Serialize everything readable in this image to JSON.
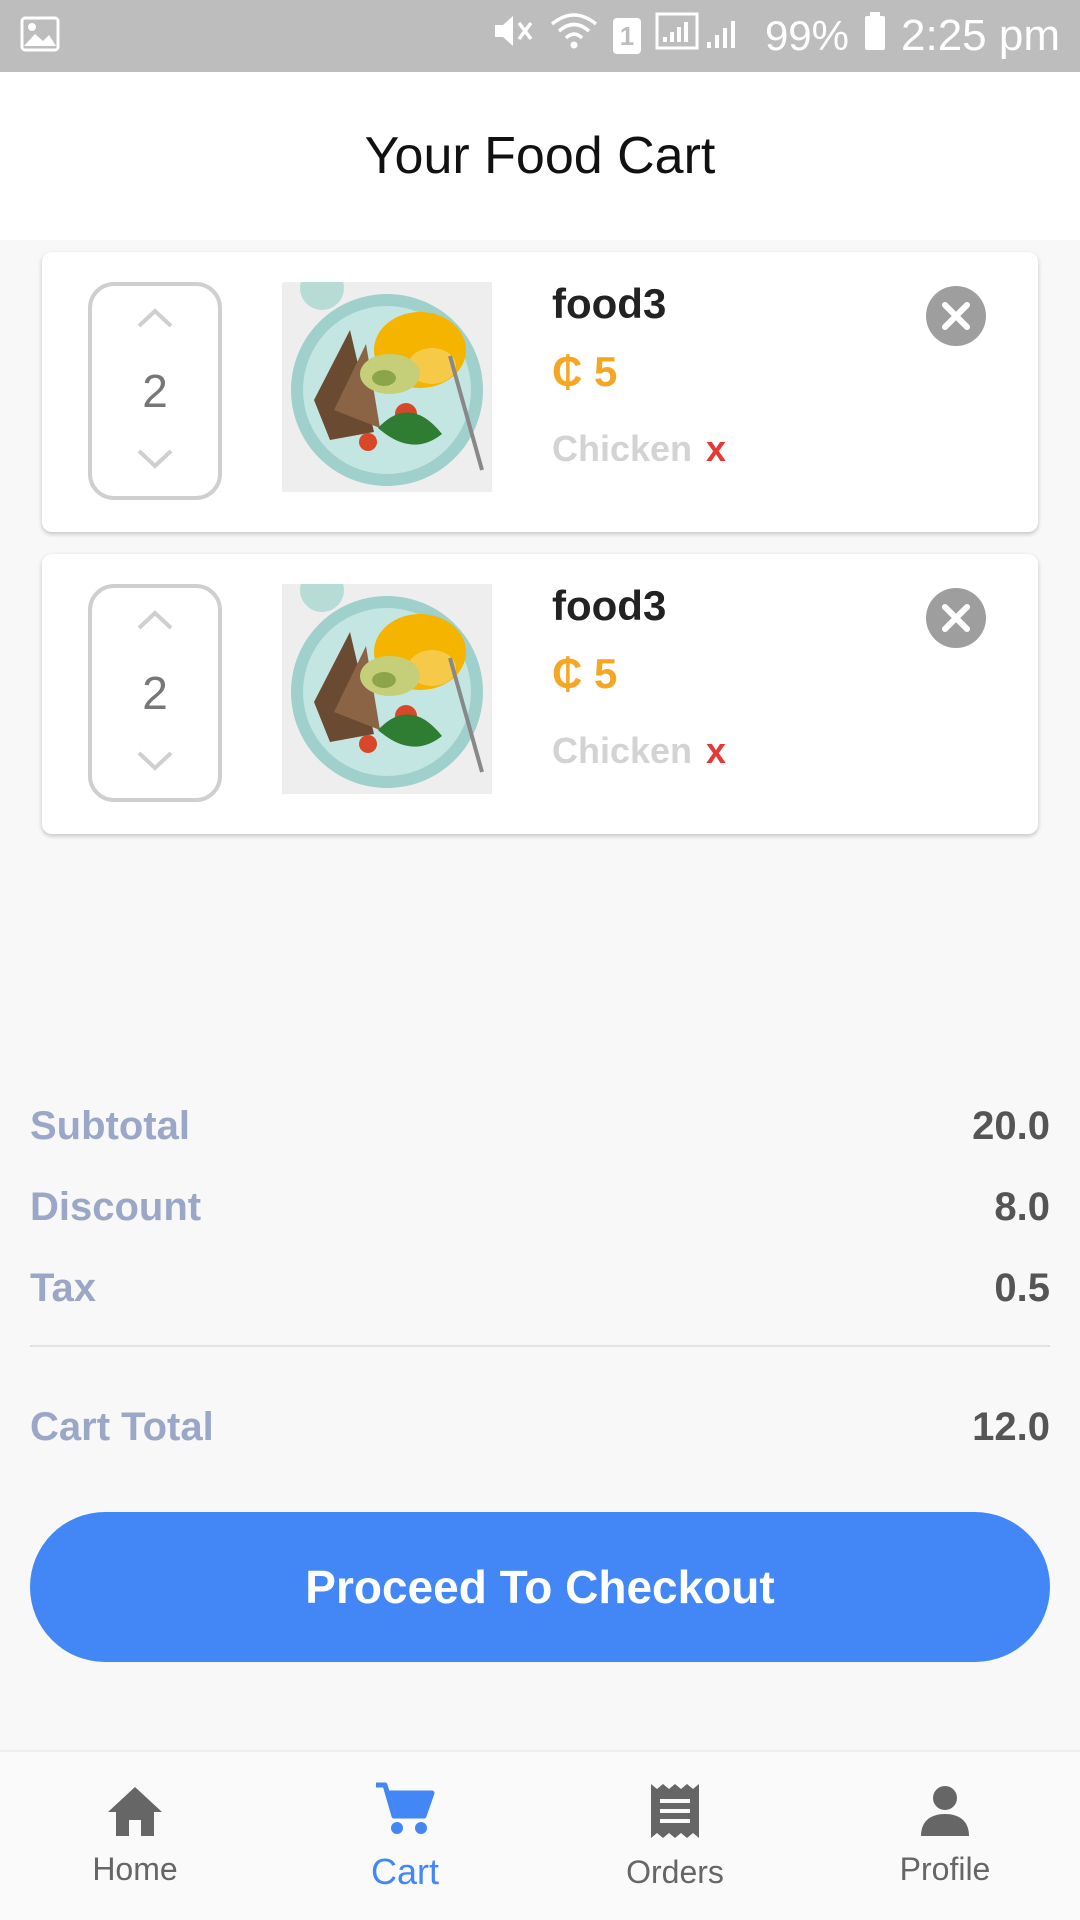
{
  "status_bar": {
    "battery": "99%",
    "time": "2:25 pm",
    "sim_slot": "1"
  },
  "header": {
    "title": "Your Food Cart"
  },
  "cart": {
    "items": [
      {
        "name": "food3",
        "price": "₵ 5",
        "quantity": "2",
        "addon": "Chicken",
        "addon_remove": "x"
      },
      {
        "name": "food3",
        "price": "₵ 5",
        "quantity": "2",
        "addon": "Chicken",
        "addon_remove": "x"
      }
    ]
  },
  "summary": {
    "subtotal_label": "Subtotal",
    "subtotal_value": "20.0",
    "discount_label": "Discount",
    "discount_value": "8.0",
    "tax_label": "Tax",
    "tax_value": "0.5",
    "total_label": "Cart Total",
    "total_value": "12.0"
  },
  "checkout": {
    "label": "Proceed To Checkout"
  },
  "nav": {
    "items": [
      {
        "label": "Home",
        "icon": "home-icon",
        "active": false
      },
      {
        "label": "Cart",
        "icon": "cart-icon",
        "active": true
      },
      {
        "label": "Orders",
        "icon": "receipt-icon",
        "active": false
      },
      {
        "label": "Profile",
        "icon": "person-icon",
        "active": false
      }
    ]
  },
  "colors": {
    "accent": "#4287f5",
    "price": "#f5a623",
    "summary_label": "#9aa7c7",
    "addon_remove": "#e53935",
    "status_bar": "#bdbdbd"
  }
}
